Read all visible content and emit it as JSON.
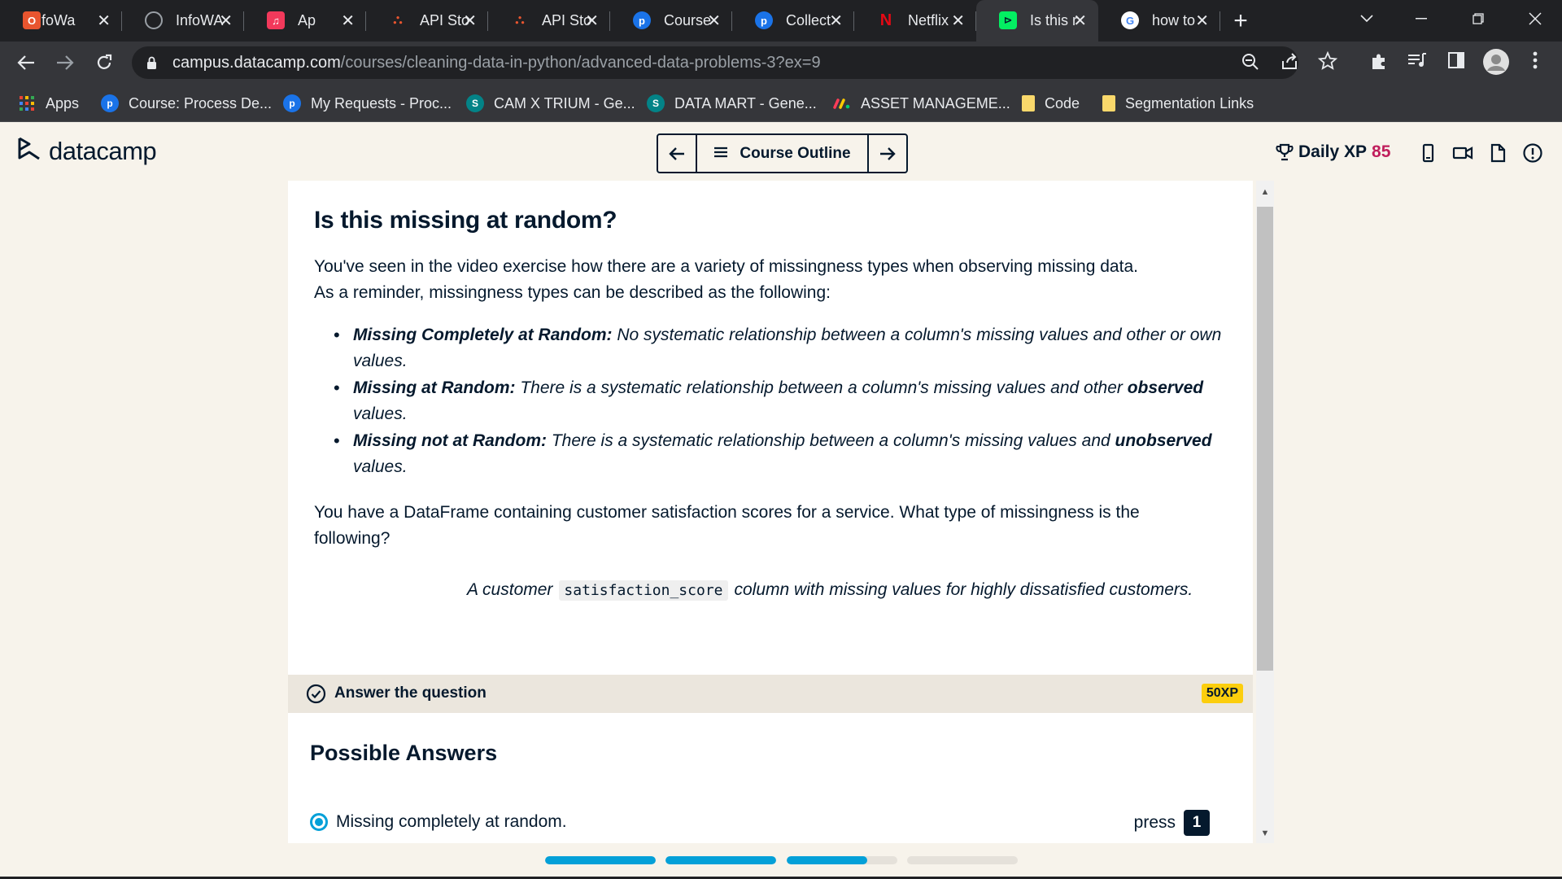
{
  "browser": {
    "tabs": [
      {
        "title": "InfoWa",
        "icon": "infowave-icon",
        "color": "#e8552f",
        "active": false
      },
      {
        "title": "InfoWA",
        "icon": "globe-icon",
        "color": "#5f6368",
        "active": false
      },
      {
        "title": "Ap",
        "icon": "music-icon",
        "color": "#f2395b",
        "active": false
      },
      {
        "title": "API Sto",
        "icon": "api-store-icon",
        "color": "#e8552f",
        "active": false
      },
      {
        "title": "API Sto",
        "icon": "api-store-icon",
        "color": "#e8552f",
        "active": false
      },
      {
        "title": "Course",
        "icon": "pluralsight-p-icon",
        "color": "#1a73e8",
        "active": false
      },
      {
        "title": "Collect",
        "icon": "pluralsight-p-icon",
        "color": "#1a73e8",
        "active": false
      },
      {
        "title": "Netflix",
        "icon": "netflix-icon",
        "color": "#e50914",
        "active": false
      },
      {
        "title": "Is this r",
        "icon": "datacamp-icon",
        "color": "#03ef62",
        "active": true
      },
      {
        "title": "how to",
        "icon": "google-icon",
        "color": "#ffffff",
        "active": false
      }
    ],
    "url_host": "campus.datacamp.com",
    "url_path": "/courses/cleaning-data-in-python/advanced-data-problems-3?ex=9",
    "bookmarks": [
      {
        "label": "Apps",
        "icon": "apps-grid-icon",
        "color": "#ea4335"
      },
      {
        "label": "Course: Process De...",
        "icon": "pluralsight-p-icon",
        "color": "#1a73e8"
      },
      {
        "label": "My Requests - Proc...",
        "icon": "pluralsight-p-icon",
        "color": "#1a73e8"
      },
      {
        "label": "CAM X TRIUM - Ge...",
        "icon": "sharepoint-icon",
        "color": "#038387"
      },
      {
        "label": "DATA MART - Gene...",
        "icon": "sharepoint-icon",
        "color": "#038387"
      },
      {
        "label": "ASSET MANAGEME...",
        "icon": "monday-icon",
        "color": "#ff3d57"
      },
      {
        "label": "Code",
        "icon": "folder-icon",
        "color": "#f9d86b"
      },
      {
        "label": "Segmentation Links",
        "icon": "folder-icon",
        "color": "#f9d86b"
      }
    ]
  },
  "header": {
    "logo_text": "datacamp",
    "course_outline_label": "Course Outline",
    "daily_xp_label": "Daily XP",
    "daily_xp_value": "85"
  },
  "exercise": {
    "title": "Is this missing at random?",
    "intro_line1": "You've seen in the video exercise how there are a variety of missingness types when observing missing data.",
    "intro_line2": "As a reminder, missingness types can be described as the following:",
    "definitions": [
      {
        "term": "Missing Completely at Random:",
        "pre": " No systematic relationship between a column's missing values and other or own values.",
        "bold": "",
        "post": ""
      },
      {
        "term": "Missing at Random:",
        "pre": " There is a systematic relationship between a column's missing values and other ",
        "bold": "observed",
        "post": " values."
      },
      {
        "term": "Missing not at Random:",
        "pre": " There is a systematic relationship between a column's missing values and ",
        "bold": "unobserved",
        "post": " values."
      }
    ],
    "question_line1": "You have a DataFrame containing customer satisfaction scores for a service. What type of missingness is the",
    "question_line2": "following?",
    "scenario_pre": "A customer",
    "scenario_code": "satisfaction_score",
    "scenario_post": "column with missing values for highly dissatisfied customers.",
    "answer_bar_label": "Answer the question",
    "xp_badge": "50XP",
    "possible_answers_title": "Possible Answers",
    "options": [
      {
        "label": "Missing completely at random.",
        "press": "press",
        "key": "1",
        "selected": true
      }
    ]
  },
  "progress": [
    1.0,
    1.0,
    0.73,
    0.0
  ],
  "colors": {
    "accent_blue": "#03a0d8",
    "navy": "#05192d",
    "xp_pink": "#c01e5c",
    "badge_yellow": "#fcce0d",
    "page_bg": "#f7f3eb"
  }
}
